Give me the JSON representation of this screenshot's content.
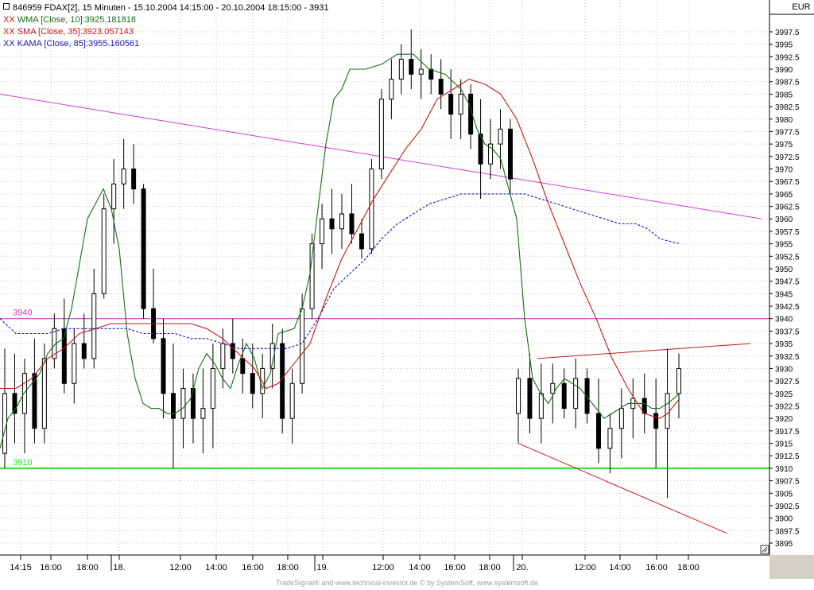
{
  "header": {
    "title": "846959  FDAX[2], 15 Minuten - 15.10.2004 14:15:00 - 20.10.2004 18:15:00 - 3931",
    "currency": "EUR",
    "indicators": [
      {
        "prefix": "XX",
        "text": "WMA [Close, 10]:3925.181818",
        "color": "#1a6b1a"
      },
      {
        "prefix": "XX",
        "text": "SMA [Close, 35]:3923.057143",
        "color": "#c81818"
      },
      {
        "prefix": "XX",
        "text": "KAMA [Close, 85]:3955.160561",
        "color": "#1818b4"
      }
    ]
  },
  "footer": "TradeSignal® and www.technical-investor.de © by  SystemSoft, www.systemsoft.de",
  "colors": {
    "candle": "#000000",
    "wma": "#1a6b1a",
    "sma": "#c81818",
    "kama": "#1818b4",
    "trend_magenta": "#d43cd4",
    "support_green": "#22ee22",
    "grid": "#c4c4c4"
  },
  "chart_data": {
    "type": "candlestick",
    "y_axis": {
      "min": 3895,
      "max": 3997.5,
      "step": 2.5,
      "side": "right"
    },
    "x_ticks": [
      "14:15",
      "16:00",
      "18:00",
      "18.",
      "12:00",
      "14:00",
      "16:00",
      "18:00",
      "19.",
      "12:00",
      "14:00",
      "16:00",
      "18:00",
      "20.",
      "12:00",
      "14:00",
      "16:00",
      "18:00"
    ],
    "horizontal_lines": [
      {
        "label": "3940",
        "value": 3940,
        "color": "#d43cd4"
      },
      {
        "label": "3910",
        "value": 3910,
        "color": "#22ee22"
      }
    ],
    "series": [
      {
        "name": "WMA [Close, 10]",
        "color": "#1a6b1a",
        "values": [
          [
            0,
            3914
          ],
          [
            10,
            3920
          ],
          [
            20,
            3922
          ],
          [
            30,
            3925
          ],
          [
            40,
            3927
          ],
          [
            50,
            3929
          ],
          [
            60,
            3933
          ],
          [
            70,
            3935
          ],
          [
            80,
            3936
          ],
          [
            90,
            3942
          ],
          [
            100,
            3951
          ],
          [
            110,
            3960
          ],
          [
            120,
            3963
          ],
          [
            130,
            3966
          ],
          [
            140,
            3962
          ],
          [
            150,
            3954
          ],
          [
            160,
            3937
          ],
          [
            170,
            3928
          ],
          [
            180,
            3923
          ],
          [
            190,
            3922
          ],
          [
            200,
            3922
          ],
          [
            210,
            3921
          ],
          [
            220,
            3921
          ],
          [
            230,
            3922
          ],
          [
            240,
            3924
          ],
          [
            250,
            3930
          ],
          [
            260,
            3933
          ],
          [
            270,
            3931
          ],
          [
            280,
            3928
          ],
          [
            290,
            3926
          ],
          [
            300,
            3931
          ],
          [
            310,
            3935
          ],
          [
            320,
            3932
          ],
          [
            330,
            3926
          ],
          [
            340,
            3929
          ],
          [
            350,
            3937
          ],
          [
            370,
            3938
          ],
          [
            380,
            3942
          ],
          [
            390,
            3949
          ],
          [
            400,
            3962
          ],
          [
            410,
            3975
          ],
          [
            420,
            3984
          ],
          [
            430,
            3986
          ],
          [
            440,
            3990
          ],
          [
            460,
            3990
          ],
          [
            480,
            3991
          ],
          [
            500,
            3993
          ],
          [
            520,
            3993
          ],
          [
            540,
            3990
          ],
          [
            560,
            3989
          ],
          [
            580,
            3986
          ],
          [
            590,
            3983
          ],
          [
            600,
            3978
          ],
          [
            610,
            3975
          ],
          [
            620,
            3974
          ],
          [
            630,
            3972
          ],
          [
            640,
            3966
          ],
          [
            650,
            3960
          ],
          [
            660,
            3940
          ],
          [
            670,
            3928
          ],
          [
            680,
            3925
          ],
          [
            690,
            3923
          ],
          [
            700,
            3926
          ],
          [
            710,
            3928
          ],
          [
            720,
            3927
          ],
          [
            730,
            3926
          ],
          [
            740,
            3924
          ],
          [
            750,
            3922
          ],
          [
            760,
            3920
          ],
          [
            770,
            3921
          ],
          [
            780,
            3922
          ],
          [
            790,
            3923
          ],
          [
            800,
            3923
          ],
          [
            810,
            3923
          ],
          [
            820,
            3922
          ],
          [
            830,
            3922
          ],
          [
            840,
            3923
          ],
          [
            855,
            3925
          ]
        ]
      },
      {
        "name": "SMA [Close, 35]",
        "color": "#c81818",
        "values": [
          [
            0,
            3926
          ],
          [
            20,
            3926
          ],
          [
            40,
            3928
          ],
          [
            60,
            3932
          ],
          [
            80,
            3934
          ],
          [
            100,
            3937
          ],
          [
            120,
            3938
          ],
          [
            140,
            3939
          ],
          [
            160,
            3939
          ],
          [
            180,
            3939
          ],
          [
            200,
            3939
          ],
          [
            220,
            3939
          ],
          [
            240,
            3939
          ],
          [
            260,
            3938
          ],
          [
            280,
            3936
          ],
          [
            300,
            3933
          ],
          [
            320,
            3930
          ],
          [
            335,
            3926
          ],
          [
            350,
            3927
          ],
          [
            370,
            3931
          ],
          [
            390,
            3935
          ],
          [
            410,
            3944
          ],
          [
            430,
            3952
          ],
          [
            450,
            3958
          ],
          [
            470,
            3964
          ],
          [
            490,
            3969
          ],
          [
            510,
            3974
          ],
          [
            530,
            3978
          ],
          [
            550,
            3984
          ],
          [
            570,
            3986
          ],
          [
            590,
            3988
          ],
          [
            610,
            3987
          ],
          [
            630,
            3985
          ],
          [
            650,
            3980
          ],
          [
            670,
            3972
          ],
          [
            690,
            3963
          ],
          [
            710,
            3955
          ],
          [
            730,
            3947
          ],
          [
            750,
            3940
          ],
          [
            770,
            3932
          ],
          [
            790,
            3926
          ],
          [
            810,
            3921
          ],
          [
            830,
            3920
          ],
          [
            840,
            3921
          ],
          [
            855,
            3924
          ]
        ]
      },
      {
        "name": "KAMA [Close, 85]",
        "color": "#1818b4",
        "values": [
          [
            0,
            3940
          ],
          [
            20,
            3937
          ],
          [
            40,
            3937
          ],
          [
            60,
            3937
          ],
          [
            80,
            3938
          ],
          [
            100,
            3938
          ],
          [
            120,
            3938
          ],
          [
            140,
            3938
          ],
          [
            160,
            3938
          ],
          [
            180,
            3937
          ],
          [
            200,
            3937
          ],
          [
            220,
            3937
          ],
          [
            240,
            3936
          ],
          [
            260,
            3936
          ],
          [
            280,
            3935
          ],
          [
            300,
            3934
          ],
          [
            320,
            3934
          ],
          [
            340,
            3934
          ],
          [
            360,
            3934
          ],
          [
            380,
            3935
          ],
          [
            400,
            3940
          ],
          [
            420,
            3946
          ],
          [
            440,
            3949
          ],
          [
            460,
            3952
          ],
          [
            480,
            3956
          ],
          [
            500,
            3959
          ],
          [
            520,
            3961
          ],
          [
            540,
            3963
          ],
          [
            560,
            3964
          ],
          [
            580,
            3965
          ],
          [
            600,
            3965
          ],
          [
            620,
            3965
          ],
          [
            640,
            3965
          ],
          [
            660,
            3965
          ],
          [
            680,
            3964
          ],
          [
            700,
            3963
          ],
          [
            720,
            3962
          ],
          [
            740,
            3961
          ],
          [
            760,
            3960
          ],
          [
            780,
            3959
          ],
          [
            800,
            3959
          ],
          [
            815,
            3958
          ],
          [
            830,
            3956
          ],
          [
            855,
            3955
          ]
        ]
      }
    ],
    "candles_ohlc": [
      [
        3913,
        3934,
        3910,
        3925
      ],
      [
        3925,
        3933,
        3915,
        3921
      ],
      [
        3921,
        3932,
        3913,
        3929
      ],
      [
        3929,
        3936,
        3915,
        3918
      ],
      [
        3918,
        3935,
        3915,
        3932
      ],
      [
        3932,
        3941,
        3930,
        3938
      ],
      [
        3938,
        3944,
        3925,
        3927
      ],
      [
        3927,
        3938,
        3923,
        3935
      ],
      [
        3935,
        3941,
        3930,
        3932
      ],
      [
        3932,
        3950,
        3930,
        3945
      ],
      [
        3945,
        3965,
        3944,
        3962
      ],
      [
        3962,
        3972,
        3955,
        3967
      ],
      [
        3967,
        3976,
        3962,
        3970
      ],
      [
        3970,
        3975,
        3963,
        3966
      ],
      [
        3966,
        3967,
        3940,
        3942
      ],
      [
        3942,
        3950,
        3935,
        3936
      ],
      [
        3936,
        3940,
        3920,
        3925
      ],
      [
        3925,
        3935,
        3910,
        3920
      ],
      [
        3920,
        3930,
        3914,
        3926
      ],
      [
        3926,
        3929,
        3915,
        3920
      ],
      [
        3920,
        3930,
        3913,
        3922
      ],
      [
        3922,
        3935,
        3914,
        3930
      ],
      [
        3930,
        3938,
        3926,
        3935
      ],
      [
        3935,
        3940,
        3929,
        3932
      ],
      [
        3932,
        3936,
        3925,
        3929
      ],
      [
        3929,
        3935,
        3922,
        3925
      ],
      [
        3925,
        3933,
        3920,
        3930
      ],
      [
        3930,
        3939,
        3926,
        3935
      ],
      [
        3935,
        3938,
        3917,
        3920
      ],
      [
        3920,
        3930,
        3915,
        3927
      ],
      [
        3927,
        3945,
        3925,
        3942
      ],
      [
        3942,
        3957,
        3940,
        3955
      ],
      [
        3955,
        3963,
        3950,
        3960
      ],
      [
        3960,
        3966,
        3953,
        3958
      ],
      [
        3958,
        3965,
        3954,
        3961
      ],
      [
        3961,
        3967,
        3955,
        3957
      ],
      [
        3957,
        3960,
        3952,
        3954
      ],
      [
        3954,
        3972,
        3953,
        3970
      ],
      [
        3970,
        3986,
        3968,
        3984
      ],
      [
        3984,
        3992,
        3980,
        3988
      ],
      [
        3988,
        3995,
        3985,
        3992
      ],
      [
        3992,
        3998,
        3986,
        3989
      ],
      [
        3989,
        3994,
        3984,
        3990
      ],
      [
        3990,
        3993,
        3985,
        3988
      ],
      [
        3988,
        3992,
        3982,
        3985
      ],
      [
        3985,
        3990,
        3976,
        3981
      ],
      [
        3981,
        3988,
        3976,
        3985
      ],
      [
        3985,
        3987,
        3974,
        3977
      ],
      [
        3977,
        3984,
        3964,
        3971
      ],
      [
        3971,
        3980,
        3968,
        3975
      ],
      [
        3975,
        3982,
        3970,
        3978
      ],
      [
        3978,
        3980,
        3965,
        3968
      ],
      [
        3921,
        3930,
        3915,
        3928
      ],
      [
        3928,
        3933,
        3917,
        3920
      ],
      [
        3920,
        3931,
        3915,
        3925
      ],
      [
        3925,
        3931,
        3919,
        3927
      ],
      [
        3927,
        3930,
        3920,
        3922
      ],
      [
        3922,
        3932,
        3918,
        3928
      ],
      [
        3928,
        3930,
        3919,
        3921
      ],
      [
        3921,
        3928,
        3911,
        3914
      ],
      [
        3914,
        3921,
        3909,
        3918
      ],
      [
        3918,
        3926,
        3912,
        3922
      ],
      [
        3922,
        3928,
        3916,
        3924
      ],
      [
        3924,
        3929,
        3917,
        3921
      ],
      [
        3921,
        3928,
        3910,
        3918
      ],
      [
        3918,
        3934,
        3904,
        3925
      ],
      [
        3925,
        3933,
        3920,
        3930
      ]
    ],
    "trendlines": [
      {
        "color": "#d43cd4",
        "from": [
          0,
          3985
        ],
        "to": [
          958,
          3960
        ]
      },
      {
        "color": "#c81818",
        "from": [
          676,
          3932
        ],
        "to": [
          944,
          3935
        ]
      },
      {
        "color": "#c81818",
        "from": [
          652,
          3915
        ],
        "to": [
          914,
          3897
        ]
      }
    ]
  }
}
